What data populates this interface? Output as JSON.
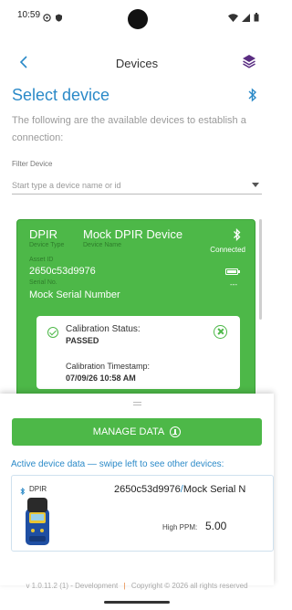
{
  "status_bar": {
    "time": "10:59"
  },
  "header": {
    "title": "Devices"
  },
  "page": {
    "title": "Select device",
    "description": "The following are the available devices to establish a connection:"
  },
  "filter": {
    "label": "Filter Device",
    "placeholder": "Start type a device name or id"
  },
  "device_card": {
    "device_type": "DPIR",
    "device_type_label": "Device Type",
    "device_name": "Mock DPIR Device",
    "device_name_label": "Device Name",
    "connection_status": "Connected",
    "asset_id_label": "Asset ID",
    "asset_id": "2650c53d9976",
    "serial_label": "Serial No.",
    "serial_number": "Mock Serial Number",
    "battery_level_text": "---",
    "calibration": {
      "status_label": "Calibration Status:",
      "status_value": "PASSED",
      "timestamp_label": "Calibration Timestamp:",
      "timestamp_value": "07/09/26 10:58 AM"
    }
  },
  "bottom_sheet": {
    "manage_button_label": "MANAGE DATA",
    "active_label": "Active device data — swipe left to see other devices:",
    "active_device": {
      "type": "DPIR",
      "asset_id": "2650c53d9976",
      "separator": "/",
      "serial": "Mock Serial N",
      "ppm_label": "High PPM:",
      "ppm_value": "5.00"
    }
  },
  "footer": {
    "version": "v 1.0.11.2 (1)",
    "environment": "- Development",
    "separator": "|",
    "copyright": "Copyright © 2026 all rights reserved"
  },
  "colors": {
    "accent_blue": "#2b8ac8",
    "status_green": "#4db848",
    "footer_orange": "#e57c2f"
  },
  "icons": [
    "back-arrow-icon",
    "layers-icon",
    "bluetooth-icon",
    "battery-icon",
    "check-circle-icon",
    "close-circle-icon",
    "download-icon",
    "device-icon"
  ]
}
